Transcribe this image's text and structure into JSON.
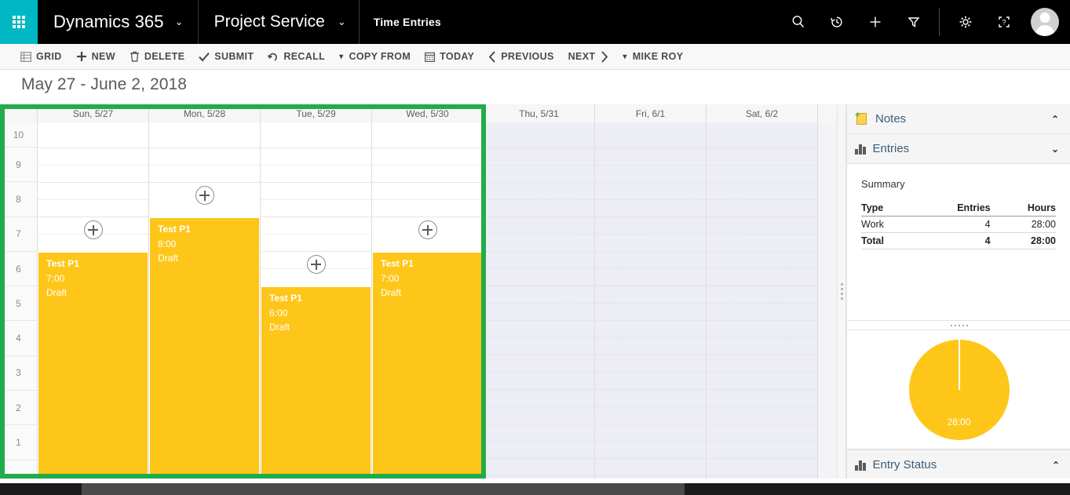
{
  "topbar": {
    "waffle_icon": "app-launcher-icon",
    "brand": "Dynamics 365",
    "brand_chevron": "⌄",
    "app": "Project Service",
    "app_chevron": "⌄",
    "page": "Time Entries",
    "icons": [
      {
        "name": "search-icon"
      },
      {
        "name": "recent-history-icon"
      },
      {
        "name": "quick-create-icon"
      },
      {
        "name": "filter-icon"
      },
      {
        "name": "settings-gear-icon"
      },
      {
        "name": "help-icon"
      }
    ],
    "avatar_name": "user-avatar"
  },
  "commandbar": {
    "items": [
      {
        "label": "GRID",
        "icon": "grid-icon",
        "name": "grid-button"
      },
      {
        "label": "NEW",
        "icon": "plus-icon",
        "name": "new-button"
      },
      {
        "label": "DELETE",
        "icon": "trash-icon",
        "name": "delete-button"
      },
      {
        "label": "SUBMIT",
        "icon": "check-icon",
        "name": "submit-button"
      },
      {
        "label": "RECALL",
        "icon": "undo-icon",
        "name": "recall-button"
      },
      {
        "label": "COPY FROM",
        "icon": "caret-down-icon",
        "name": "copy-from-button"
      },
      {
        "label": "TODAY",
        "icon": "calendar-icon",
        "name": "today-button"
      },
      {
        "label": "PREVIOUS",
        "icon": "chevron-left-icon",
        "name": "previous-button"
      },
      {
        "label": "NEXT",
        "icon": "chevron-right-icon",
        "name": "next-button"
      },
      {
        "label": "MIKE ROY",
        "icon": "caret-down-icon",
        "name": "user-filter-button"
      }
    ]
  },
  "calendar": {
    "date_range_title": "May 27 - June 2, 2018",
    "selection_color": "#22AB4B",
    "event_color": "#FFC61A",
    "day_headers": [
      "Sun, 5/27",
      "Mon, 5/28",
      "Tue, 5/29",
      "Wed, 5/30",
      "Thu, 5/31",
      "Fri, 6/1",
      "Sat, 6/2"
    ],
    "time_labels": [
      "10",
      "9",
      "8",
      "7",
      "6",
      "5",
      "4",
      "3",
      "2",
      "1"
    ],
    "events": [
      {
        "day": "Sun, 5/27",
        "title": "Test P1",
        "hours": "7:00",
        "status": "Draft"
      },
      {
        "day": "Mon, 5/28",
        "title": "Test P1",
        "hours": "8:00",
        "status": "Draft"
      },
      {
        "day": "Tue, 5/29",
        "title": "Test P1",
        "hours": "6:00",
        "status": "Draft"
      },
      {
        "day": "Wed, 5/30",
        "title": "Test P1",
        "hours": "7:00",
        "status": "Draft"
      }
    ],
    "add_buttons": [
      {
        "day": "Sun, 5/27",
        "name": "add-entry-sun"
      },
      {
        "day": "Mon, 5/28",
        "name": "add-entry-mon"
      },
      {
        "day": "Tue, 5/29",
        "name": "add-entry-tue"
      },
      {
        "day": "Wed, 5/30",
        "name": "add-entry-wed"
      }
    ]
  },
  "rightpanel": {
    "notes": {
      "label": "Notes",
      "icon": "notes-icon",
      "chevron": "⌃"
    },
    "entries": {
      "label": "Entries",
      "icon": "bar-chart-icon",
      "chevron": "⌄"
    },
    "summary": {
      "heading": "Summary",
      "columns": [
        "Type",
        "Entries",
        "Hours"
      ],
      "rows": [
        {
          "type": "Work",
          "entries": "4",
          "hours": "28:00"
        },
        {
          "type": "Total",
          "entries": "4",
          "hours": "28:00"
        }
      ]
    },
    "entry_status": {
      "label": "Entry Status",
      "icon": "bar-chart-icon",
      "chevron": "⌃"
    }
  },
  "chart_data": {
    "type": "pie",
    "title": "Entries",
    "categories": [
      "Work"
    ],
    "values": [
      28
    ],
    "labels": [
      "28:00"
    ],
    "colors": [
      "#FFC61A"
    ],
    "total_label": "28:00",
    "legend": "none",
    "notes": "Single full-circle slice representing 28:00 hours of Work"
  }
}
